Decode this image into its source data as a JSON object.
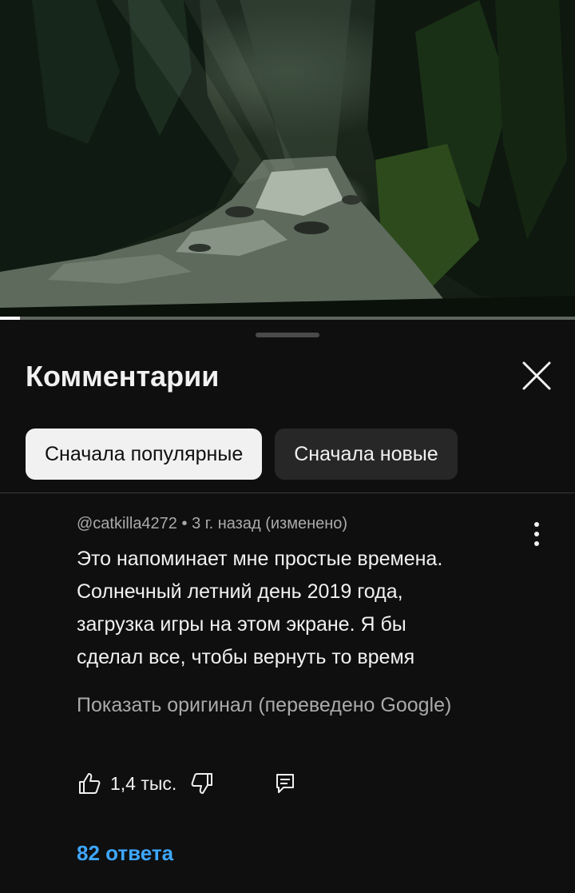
{
  "video": {
    "progress": 0.035
  },
  "sheet": {
    "title": "Комментарии",
    "close_icon": "close-icon",
    "sort_chips": [
      {
        "label": "Сначала популярные",
        "active": true
      },
      {
        "label": "Сначала новые",
        "active": false
      }
    ]
  },
  "comment": {
    "author": "@catkilla4272",
    "separator": "•",
    "time": "3 г. назад (изменено)",
    "text_lines": [
      "Это напоминает мне простые времена.",
      "Солнечный летний день 2019 года,",
      "загрузка игры на этом экране. Я бы",
      "сделал все, чтобы вернуть то время"
    ],
    "translation_note": "Показать оригинал (переведено Google)",
    "likes": "1,4 тыс.",
    "replies_label": "82 ответа",
    "icons": {
      "more": "more-vert-icon",
      "like": "thumb-up-icon",
      "dislike": "thumb-down-icon",
      "reply": "reply-icon"
    }
  },
  "colors": {
    "background": "#0f0f0f",
    "chip_active_bg": "#f1f1f1",
    "chip_inactive_bg": "#272727",
    "link": "#3ea6ff",
    "secondary_text": "#aaaaaa"
  }
}
